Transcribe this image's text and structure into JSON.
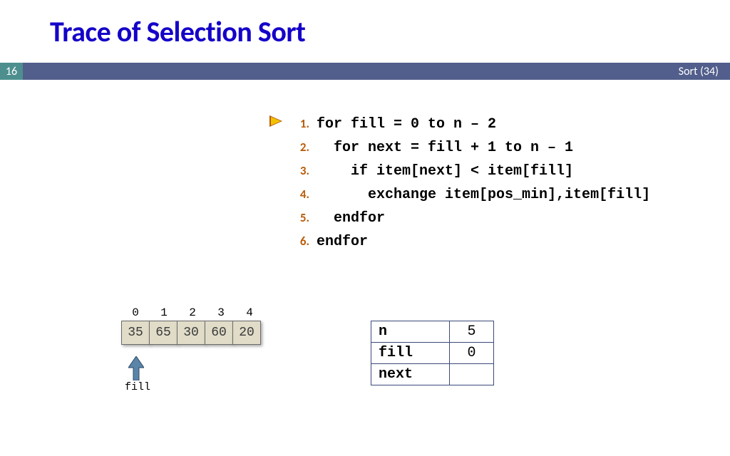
{
  "title": "Trace of Selection Sort",
  "slide_number": "16",
  "header_right": "Sort (34)",
  "code": {
    "lines": [
      {
        "n": "1.",
        "text": "for fill = 0 to n – 2"
      },
      {
        "n": "2.",
        "text": "  for next = fill + 1 to n – 1"
      },
      {
        "n": "3.",
        "text": "    if item[next] < item[fill]"
      },
      {
        "n": "4.",
        "text": "      exchange item[pos_min],item[fill]"
      },
      {
        "n": "5.",
        "text": "  endfor"
      },
      {
        "n": "6.",
        "text": "endfor"
      }
    ]
  },
  "array": {
    "indices": [
      "0",
      "1",
      "2",
      "3",
      "4"
    ],
    "values": [
      "35",
      "65",
      "30",
      "60",
      "20"
    ]
  },
  "fill_arrow_label": "fill",
  "vars": {
    "rows": [
      {
        "k": "n",
        "v": "5"
      },
      {
        "k": "fill",
        "v": "0"
      },
      {
        "k": "next",
        "v": ""
      }
    ]
  }
}
